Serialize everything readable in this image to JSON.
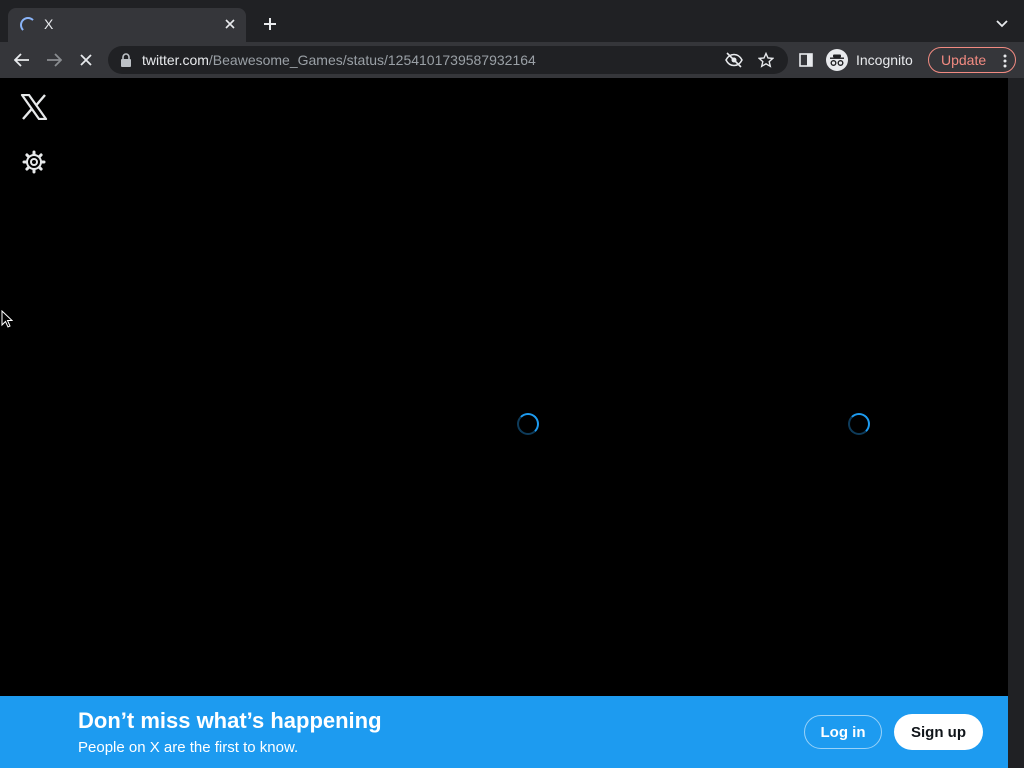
{
  "browser": {
    "tab": {
      "title": "X"
    },
    "address": {
      "host": "twitter.com",
      "path": "/Beawesome_Games/status/1254101739587932164"
    },
    "profile_label": "Incognito",
    "update_label": "Update"
  },
  "icons": {
    "logo": "x-logo-icon",
    "settings": "gear-icon",
    "loading": "spinner-icon"
  },
  "banner": {
    "title": "Don’t miss what’s happening",
    "subtitle": "People on X are the first to know.",
    "login_label": "Log in",
    "signup_label": "Sign up"
  },
  "colors": {
    "accent": "#1d9bf0",
    "page_background": "#000000",
    "chrome_dark": "#202124",
    "chrome_toolbar": "#35363a",
    "update_accent": "#f28b82"
  }
}
